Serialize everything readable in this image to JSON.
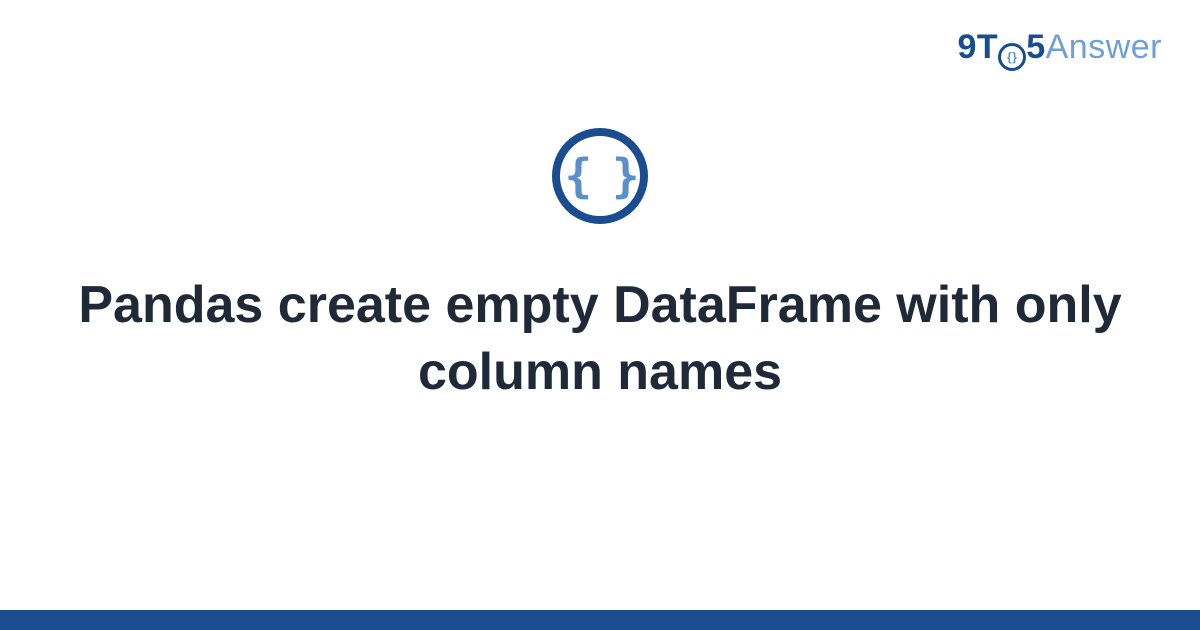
{
  "brand": {
    "prefix": "9T",
    "inner": "{}",
    "five": "5",
    "suffix": "Answer"
  },
  "logo": {
    "braces": "{ }"
  },
  "title": "Pandas create empty DataFrame with only column names"
}
